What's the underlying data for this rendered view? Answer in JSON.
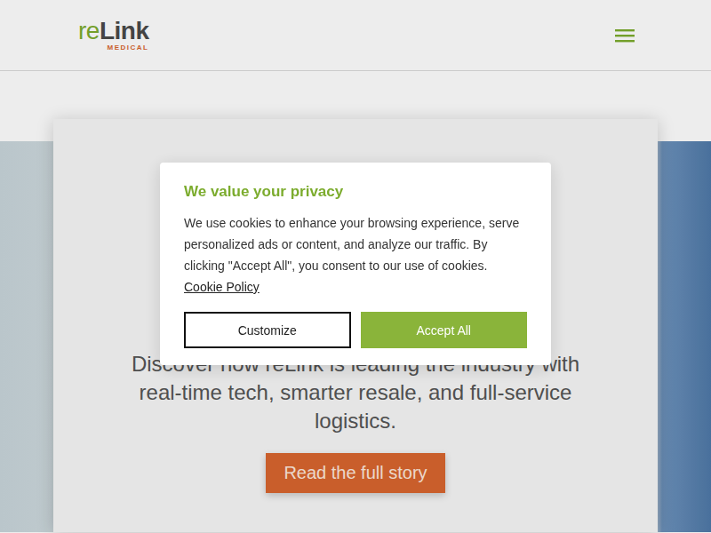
{
  "header": {
    "logo": {
      "prefix": "re",
      "name": "Link",
      "tagline": "MEDICAL"
    }
  },
  "hero": {
    "subtitle": "Discover how reLink is leading the industry with real-time tech, smarter resale, and full-service logistics.",
    "button": "Read the full story"
  },
  "cookie_dialog": {
    "title": "We value your privacy",
    "body": "We use cookies to enhance your browsing experience, serve personalized ads or content, and analyze our traffic. By clicking \"Accept All\", you consent to our use of cookies.",
    "link": "Cookie Policy",
    "buttons": [
      {
        "label": "Customize",
        "kind": "outline"
      },
      {
        "label": "Accept All",
        "kind": "primary"
      }
    ]
  }
}
